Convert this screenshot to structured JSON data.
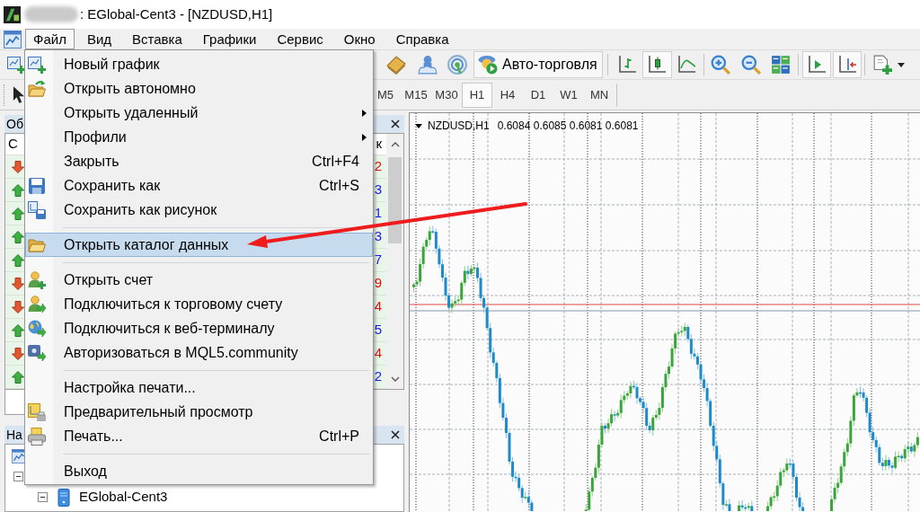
{
  "window": {
    "title": ": EGlobal-Cent3 - [NZDUSD,H1]"
  },
  "menu_bar": [
    {
      "label": "Файл",
      "selected": true
    },
    {
      "label": "Вид",
      "selected": false
    },
    {
      "label": "Вставка",
      "selected": false
    },
    {
      "label": "Графики",
      "selected": false
    },
    {
      "label": "Сервис",
      "selected": false
    },
    {
      "label": "Окно",
      "selected": false
    },
    {
      "label": "Справка",
      "selected": false
    }
  ],
  "toolbar": {
    "auto_trading": "Авто-торговля",
    "chart_types": [
      {
        "selected": false
      },
      {
        "selected": true
      },
      {
        "selected": false
      }
    ],
    "chart_toggles": [
      {
        "on": true
      },
      {
        "on": true
      }
    ]
  },
  "timeframes": [
    {
      "label": "M5",
      "selected": false
    },
    {
      "label": "M15",
      "selected": false
    },
    {
      "label": "M30",
      "selected": false
    },
    {
      "label": "H1",
      "selected": true
    },
    {
      "label": "H4",
      "selected": false
    },
    {
      "label": "D1",
      "selected": false
    },
    {
      "label": "W1",
      "selected": false
    },
    {
      "label": "MN",
      "selected": false
    }
  ],
  "market_watch": {
    "title": "Об",
    "columns": [
      "С",
      "к"
    ],
    "rows": [
      {
        "kind": "down",
        "value": "2"
      },
      {
        "kind": "up",
        "value": "3"
      },
      {
        "kind": "up",
        "value": "1"
      },
      {
        "kind": "up",
        "value": "3"
      },
      {
        "kind": "up",
        "value": "7"
      },
      {
        "kind": "down",
        "value": "9"
      },
      {
        "kind": "down",
        "value": "4"
      },
      {
        "kind": "up",
        "value": "5"
      },
      {
        "kind": "down",
        "value": "4"
      },
      {
        "kind": "up",
        "value": "2"
      }
    ],
    "tabs": [
      {
        "selected": true
      }
    ]
  },
  "navigator": {
    "title": "На",
    "tree": [
      {
        "kind": "root",
        "children": [
          {
            "kind": "folder",
            "expanded": true,
            "children": [
              {
                "kind": "server",
                "label": "EGlobal-Cent3",
                "expanded": true
              }
            ]
          }
        ]
      }
    ]
  },
  "file_menu": [
    {
      "kind": "item",
      "label": "Новый график",
      "submenu": false,
      "selected": false
    },
    {
      "kind": "item",
      "label": "Открыть автономно",
      "submenu": false,
      "selected": false
    },
    {
      "kind": "item",
      "label": "Открыть удаленный",
      "submenu": true,
      "selected": false
    },
    {
      "kind": "item",
      "label": "Профили",
      "submenu": true,
      "selected": false
    },
    {
      "kind": "item",
      "label": "Закрыть",
      "shortcut": "Ctrl+F4",
      "submenu": false,
      "selected": false
    },
    {
      "kind": "item",
      "label": "Сохранить как",
      "shortcut": "Ctrl+S",
      "submenu": false,
      "selected": false
    },
    {
      "kind": "item",
      "label": "Сохранить как рисунок",
      "submenu": false,
      "selected": false
    },
    {
      "kind": "separator"
    },
    {
      "kind": "item",
      "label": "Открыть каталог данных",
      "submenu": false,
      "selected": true
    },
    {
      "kind": "separator"
    },
    {
      "kind": "item",
      "label": "Открыть счет",
      "submenu": false,
      "selected": false
    },
    {
      "kind": "item",
      "label": "Подключиться к торговому счету",
      "submenu": false,
      "selected": false
    },
    {
      "kind": "item",
      "label": "Подключиться к веб-терминалу",
      "submenu": false,
      "selected": false
    },
    {
      "kind": "item",
      "label": "Авторизоваться в MQL5.community",
      "submenu": false,
      "selected": false
    },
    {
      "kind": "separator"
    },
    {
      "kind": "item",
      "label": "Настройка печати...",
      "submenu": false,
      "selected": false
    },
    {
      "kind": "item",
      "label": "Предварительный просмотр",
      "submenu": false,
      "selected": false
    },
    {
      "kind": "item",
      "label": "Печать...",
      "shortcut": "Ctrl+P",
      "submenu": false,
      "selected": false
    },
    {
      "kind": "separator"
    },
    {
      "kind": "item",
      "label": "Выход",
      "submenu": false,
      "selected": false
    }
  ],
  "chart": {
    "symbol": "NZDUSD,H1",
    "ohlc": "0.6084 0.6085 0.6081 0.6081"
  }
}
